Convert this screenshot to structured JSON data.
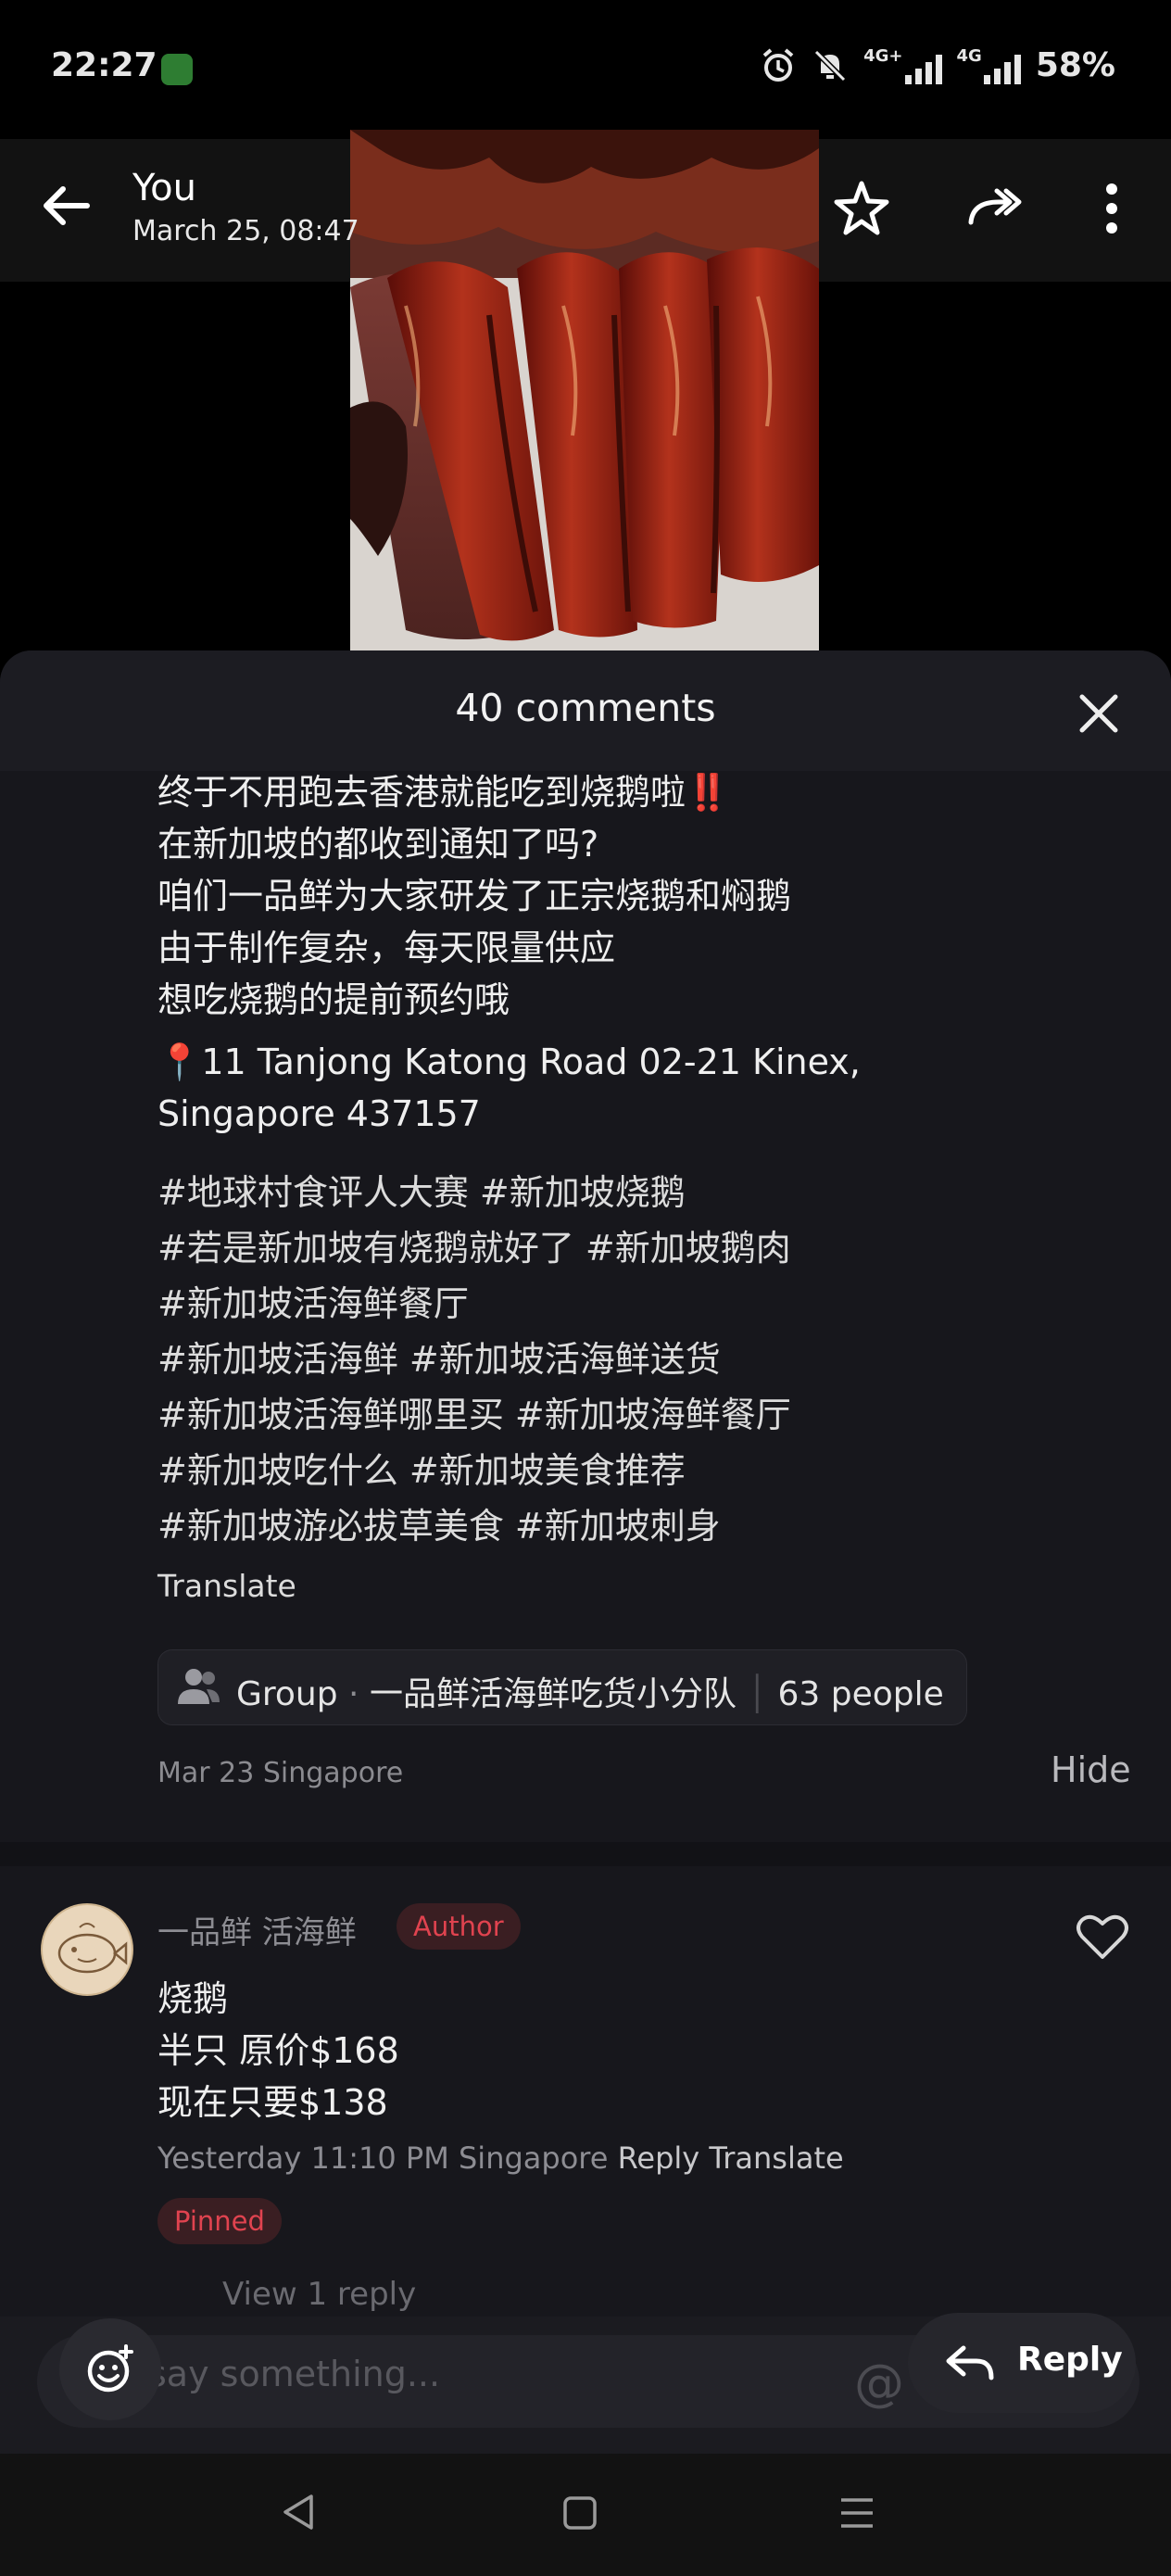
{
  "status_bar": {
    "time": "22:27",
    "battery": "58%",
    "network_1": "4G+",
    "network_2": "4G",
    "icons": [
      "app-icon",
      "alarm-icon",
      "mute-icon",
      "signal-icon",
      "signal-icon",
      "battery-text"
    ]
  },
  "header": {
    "title": "You",
    "subtitle": "March 25, 08:47",
    "icons": [
      "back-arrow-icon",
      "star-icon",
      "forward-icon",
      "more-vert-icon"
    ]
  },
  "sheet": {
    "comments_count": "40 comments",
    "post_lines": [
      "终于不用跑去香港就能吃到烧鹅啦‼️",
      "在新加坡的都收到通知了吗?",
      "咱们一品鲜为大家研发了正宗烧鹅和焖鹅",
      "由于制作复杂，每天限量供应",
      "想吃烧鹅的提前预约哦"
    ],
    "address_line_1": "📍11 Tanjong Katong Road 02-21 Kinex,",
    "address_line_2": "Singapore 437157",
    "hashtag_lines": [
      "#地球村食评人大赛 #新加坡烧鹅",
      "#若是新加坡有烧鹅就好了 #新加坡鹅肉",
      "#新加坡活海鲜餐厅",
      "#新加坡活海鲜 #新加坡活海鲜送货",
      "#新加坡活海鲜哪里买 #新加坡海鲜餐厅",
      "#新加坡吃什么 #新加坡美食推荐",
      "#新加坡游必拔草美食 #新加坡刺身"
    ],
    "translate_label": "Translate",
    "group_chip": {
      "label": "Group",
      "name": "一品鲜活海鲜吃货小分队",
      "members": "63 people"
    },
    "post_meta": "Mar 23 Singapore",
    "hide_label": "Hide"
  },
  "comment": {
    "author_name": "一品鲜 活海鲜",
    "author_badge": "Author",
    "lines": [
      "烧鹅",
      "半只 原价$168",
      "现在只要$138"
    ],
    "time_location": "Yesterday 11:10 PM Singapore",
    "reply_label": "Reply",
    "translate_label": "Translate",
    "pinned_label": "Pinned",
    "view_replies": "View 1 reply"
  },
  "composer": {
    "placeholder": "say something...",
    "reply_button": "Reply"
  },
  "colors": {
    "sheet_bg": "#17171c",
    "accent_red": "#e0434f",
    "badge_bg": "#3a1e22"
  }
}
